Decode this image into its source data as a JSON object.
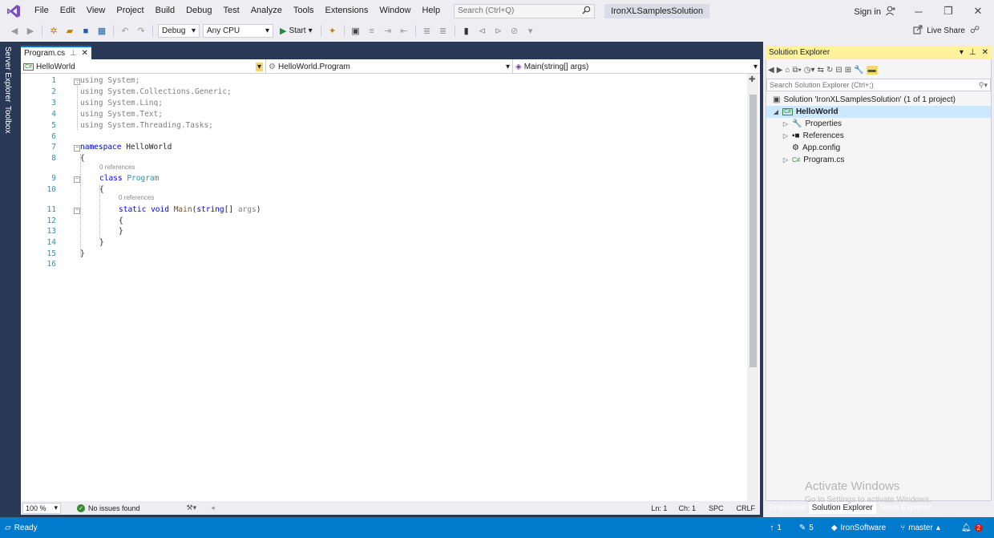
{
  "menu": {
    "items": [
      "File",
      "Edit",
      "View",
      "Project",
      "Build",
      "Debug",
      "Test",
      "Analyze",
      "Tools",
      "Extensions",
      "Window",
      "Help"
    ],
    "search_placeholder": "Search (Ctrl+Q)",
    "solution_name": "IronXLSamplesSolution",
    "signin": "Sign in"
  },
  "toolbar": {
    "config": "Debug",
    "platform": "Any CPU",
    "start": "Start",
    "liveshare": "Live Share"
  },
  "side_tabs": [
    "Server Explorer",
    "Toolbox"
  ],
  "editor": {
    "tab_label": "Program.cs",
    "nav_project": "HelloWorld",
    "nav_type": "HelloWorld.Program",
    "nav_member": "Main(string[] args)",
    "codelens": "0 references",
    "lines": [
      {
        "n": "1",
        "kind": "using",
        "kw": "using",
        "rest": "System;"
      },
      {
        "n": "2",
        "kind": "using",
        "kw": "using",
        "rest": "System.Collections.Generic;"
      },
      {
        "n": "3",
        "kind": "using",
        "kw": "using",
        "rest": "System.Linq;"
      },
      {
        "n": "4",
        "kind": "using",
        "kw": "using",
        "rest": "System.Text;"
      },
      {
        "n": "5",
        "kind": "using",
        "kw": "using",
        "rest": "System.Threading.Tasks;"
      },
      {
        "n": "6",
        "kind": "blank"
      },
      {
        "n": "7",
        "kind": "namespace",
        "kw": "namespace",
        "rest": "HelloWorld"
      },
      {
        "n": "8",
        "kind": "plain",
        "rest": "{"
      },
      {
        "n": "9",
        "kind": "class",
        "kw": "class",
        "rest": "Program"
      },
      {
        "n": "10",
        "kind": "plain",
        "rest": "{"
      },
      {
        "n": "11",
        "kind": "method"
      },
      {
        "n": "12",
        "kind": "plain",
        "rest": "{"
      },
      {
        "n": "13",
        "kind": "plain",
        "rest": "}"
      },
      {
        "n": "14",
        "kind": "plain",
        "rest": "}"
      },
      {
        "n": "15",
        "kind": "plain",
        "rest": "}"
      },
      {
        "n": "16",
        "kind": "blank"
      }
    ],
    "method_tokens": {
      "static": "static",
      "void": "void",
      "name": "Main",
      "open": "(",
      "type": "string",
      "brackets": "[]",
      "param": "args",
      "close": ")"
    }
  },
  "editor_status": {
    "zoom": "100 %",
    "issues": "No issues found",
    "ln": "Ln: 1",
    "ch": "Ch: 1",
    "spc": "SPC",
    "crlf": "CRLF"
  },
  "solution_explorer": {
    "title": "Solution Explorer",
    "search_placeholder": "Search Solution Explorer (Ctrl+;)",
    "solution_label": "Solution 'IronXLSamplesSolution' (1 of 1 project)",
    "project": "HelloWorld",
    "items": [
      "Properties",
      "References",
      "App.config",
      "Program.cs"
    ],
    "tabs": [
      "Properties",
      "Solution Explorer",
      "Team Explorer"
    ]
  },
  "watermark": {
    "title": "Activate Windows",
    "subtitle": "Go to Settings to activate Windows."
  },
  "statusbar": {
    "ready": "Ready",
    "up": "1",
    "edits": "5",
    "org": "IronSoftware",
    "branch": "master",
    "notifications": "2"
  }
}
